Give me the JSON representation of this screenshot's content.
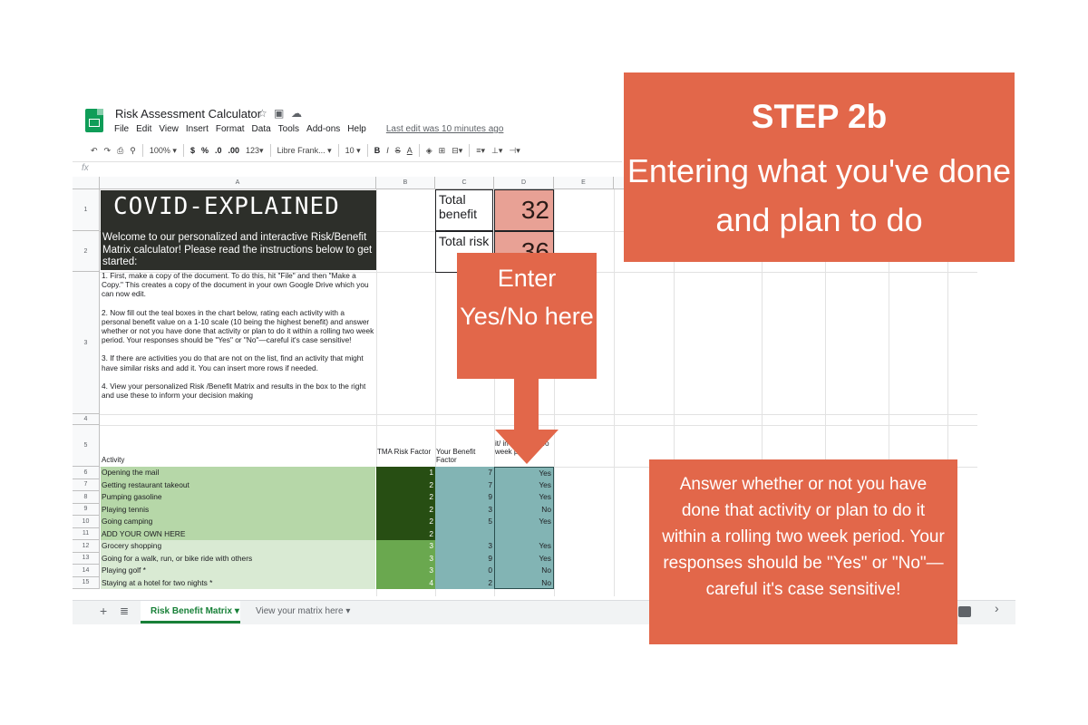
{
  "app": {
    "title": "Risk Assessment Calculator",
    "menu": [
      "File",
      "Edit",
      "View",
      "Insert",
      "Format",
      "Data",
      "Tools",
      "Add-ons",
      "Help"
    ],
    "last_edit": "Last edit was 10 minutes ago"
  },
  "toolbar": {
    "zoom": "100%",
    "currency": "$",
    "percent": "%",
    "dec_less": ".0",
    "dec_more": ".00",
    "format_more": "123",
    "font": "Libre Frank...",
    "font_size": "10",
    "bold": "B",
    "italic": "I",
    "strike": "S",
    "text_color": "A"
  },
  "formula_bar": {
    "fx": "fx"
  },
  "columns": [
    "A",
    "B",
    "C",
    "D",
    "E"
  ],
  "rows": [
    "1",
    "2",
    "3",
    "4",
    "5",
    "6",
    "7",
    "8",
    "9",
    "10",
    "11",
    "12",
    "13",
    "14",
    "15"
  ],
  "banner": {
    "title": "COVID-EXPLAINED",
    "subtitle": "Welcome to our personalized and interactive Risk/Benefit Matrix calculator! Please read the instructions below to get started:"
  },
  "instructions": [
    "1. First, make a copy  of the document. To do this, hit \"File\" and then \"Make a Copy.\" This creates a copy of the document in your own Google Drive which you can now edit.",
    "2. Now fill out the teal boxes in the chart below, rating each activity with a personal benefit value on a 1-10 scale (10 being the highest benefit) and answer whether or not you have done that activity or plan to do it within a rolling two week period. Your responses should be \"Yes\" or \"No\"—careful it's case sensitive!",
    "3. If there are activities you do that are not on the list, find an activity that might have similar risks and add it. You can insert more rows if needed.",
    "4. View your personalized Risk /Benefit Matrix and results in the box to the right and use these to inform your decision making"
  ],
  "totals": {
    "benefit_label": "Total benefit",
    "benefit_value": "32",
    "risk_label": "Total risk",
    "risk_value": "36"
  },
  "table_headers": {
    "activity": "Activity",
    "tma": "TMA Risk Factor",
    "benefit": "Your Benefit Factor",
    "done": "it/ in a rolling two week period"
  },
  "table_rows": [
    {
      "activity": "Opening the mail",
      "tma": "1",
      "benefit": "7",
      "done": "Yes"
    },
    {
      "activity": "Getting restaurant takeout",
      "tma": "2",
      "benefit": "7",
      "done": "Yes"
    },
    {
      "activity": "Pumping gasoline",
      "tma": "2",
      "benefit": "9",
      "done": "Yes"
    },
    {
      "activity": "Playing tennis",
      "tma": "2",
      "benefit": "3",
      "done": "No"
    },
    {
      "activity": "Going camping",
      "tma": "2",
      "benefit": "5",
      "done": "Yes"
    },
    {
      "activity": "ADD YOUR OWN HERE",
      "tma": "2",
      "benefit": "",
      "done": ""
    },
    {
      "activity": "Grocery shopping",
      "tma": "3",
      "benefit": "3",
      "done": "Yes"
    },
    {
      "activity": "Going for a walk, run, or bike ride with others",
      "tma": "3",
      "benefit": "9",
      "done": "Yes"
    },
    {
      "activity": "Playing golf *",
      "tma": "3",
      "benefit": "0",
      "done": "No"
    },
    {
      "activity": "Staying at a hotel for two nights *",
      "tma": "4",
      "benefit": "2",
      "done": "No"
    }
  ],
  "tabs": {
    "active": "Risk Benefit Matrix",
    "other": "View your matrix here"
  },
  "callouts": {
    "step_title": "STEP 2b",
    "step_sub": "Entering what you've done and plan to do",
    "enter": "Enter Yes/No here",
    "answer": "Answer whether or not you have done that activity or plan to do it within a rolling two week period. Your responses should be \"Yes\" or \"No\"—careful it's case sensitive!"
  },
  "colors": {
    "accent": "#e2674a",
    "teal": "#82b4b4",
    "dark_green": "#274e13",
    "mid_green": "#6aa84f",
    "light_green": "#b6d7a8",
    "pale_green": "#d9ead3",
    "total_fill": "#e8a195"
  }
}
